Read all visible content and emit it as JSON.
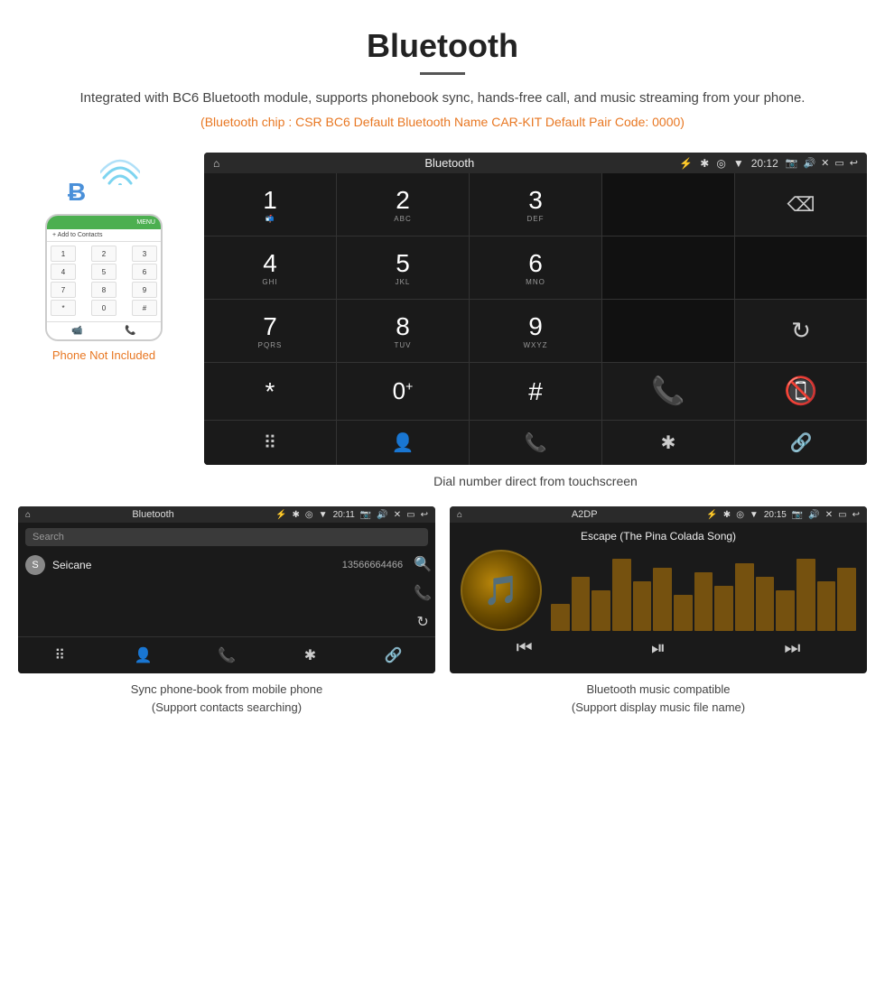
{
  "page": {
    "title": "Bluetooth",
    "description": "Integrated with BC6 Bluetooth module, supports phonebook sync, hands-free call, and music streaming from your phone.",
    "specs": "(Bluetooth chip : CSR BC6    Default Bluetooth Name CAR-KIT    Default Pair Code: 0000)",
    "dial_caption": "Dial number direct from touchscreen",
    "phonebook_caption": "Sync phone-book from mobile phone\n(Support contacts searching)",
    "music_caption": "Bluetooth music compatible\n(Support display music file name)"
  },
  "phone_label": "Phone Not Included",
  "car_screen": {
    "status_bar": {
      "home": "⌂",
      "title": "Bluetooth",
      "usb": "⚡",
      "time": "20:12",
      "camera": "📷",
      "volume": "🔊",
      "close": "✕",
      "rect": "▭",
      "back": "↩"
    },
    "dialpad": [
      {
        "num": "1",
        "sub": ""
      },
      {
        "num": "2",
        "sub": "ABC"
      },
      {
        "num": "3",
        "sub": "DEF"
      },
      {
        "num": "",
        "sub": ""
      },
      {
        "num": "⌫",
        "sub": ""
      }
    ],
    "dialpad2": [
      {
        "num": "4",
        "sub": "GHI"
      },
      {
        "num": "5",
        "sub": "JKL"
      },
      {
        "num": "6",
        "sub": "MNO"
      },
      {
        "num": "",
        "sub": ""
      },
      {
        "num": "",
        "sub": ""
      }
    ],
    "dialpad3": [
      {
        "num": "7",
        "sub": "PQRS"
      },
      {
        "num": "8",
        "sub": "TUV"
      },
      {
        "num": "9",
        "sub": "WXYZ"
      },
      {
        "num": "",
        "sub": ""
      },
      {
        "num": "↺",
        "sub": ""
      }
    ],
    "dialpad4": [
      {
        "num": "*",
        "sub": ""
      },
      {
        "num": "0+",
        "sub": ""
      },
      {
        "num": "#",
        "sub": ""
      },
      {
        "num": "📞",
        "sub": "call"
      },
      {
        "num": "📞",
        "sub": "hangup"
      }
    ],
    "bottom_icons": [
      "⠿",
      "👤",
      "📞",
      "✱",
      "🔗"
    ]
  },
  "phonebook_screen": {
    "status_bar": {
      "home": "⌂",
      "title": "Bluetooth",
      "time": "20:11"
    },
    "search_placeholder": "Search",
    "contact": {
      "letter": "S",
      "name": "Seicane",
      "number": "13566664466"
    },
    "bottom_icons": [
      "⠿",
      "👤",
      "📞",
      "✱",
      "🔗"
    ]
  },
  "music_screen": {
    "status_bar": {
      "home": "⌂",
      "title": "A2DP",
      "time": "20:15"
    },
    "song_title": "Escape (The Pina Colada Song)",
    "eq_bars": [
      30,
      60,
      45,
      80,
      55,
      70,
      40,
      65,
      50,
      75,
      60,
      45,
      80,
      55,
      70
    ],
    "controls": [
      "⏮",
      "⏯",
      "⏭"
    ]
  }
}
